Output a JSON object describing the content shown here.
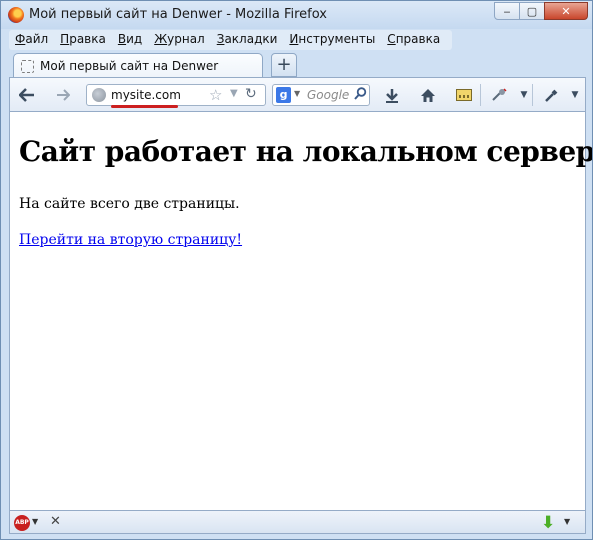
{
  "window": {
    "title": "Мой первый сайт на Denwer - Mozilla Firefox",
    "controls": {
      "minimize": "▭",
      "maximize": "▢",
      "close": "✕"
    }
  },
  "menu": {
    "items": [
      {
        "label": "Файл"
      },
      {
        "label": "Правка"
      },
      {
        "label": "Вид"
      },
      {
        "label": "Журнал"
      },
      {
        "label": "Закладки"
      },
      {
        "label": "Инструменты"
      },
      {
        "label": "Справка"
      }
    ]
  },
  "tab": {
    "label": "Мой первый сайт на Denwer",
    "new_tab": "+"
  },
  "nav": {
    "url": "mysite.com",
    "search_placeholder": "Google",
    "search_engine_letter": "g",
    "icons": {
      "back": "back-arrow-icon",
      "forward": "forward-arrow-icon",
      "star": "bookmark-star-icon",
      "reload": "reload-icon",
      "downloads": "download-icon",
      "home": "home-icon",
      "bookmarks": "bookmarks-bar-icon",
      "addon": "addon-icon",
      "tools": "eyedropper-icon"
    }
  },
  "page": {
    "heading": "Сайт работает на локальном сервере!",
    "paragraph": "На сайте всего две страницы.",
    "link": "Перейти на вторую страницу!"
  },
  "addon_bar": {
    "abp_label": "ABP",
    "close": "✕"
  },
  "colors": {
    "link": "#0000ee",
    "url_underline": "#cc1f1f",
    "chrome": "#cfe0f3"
  }
}
